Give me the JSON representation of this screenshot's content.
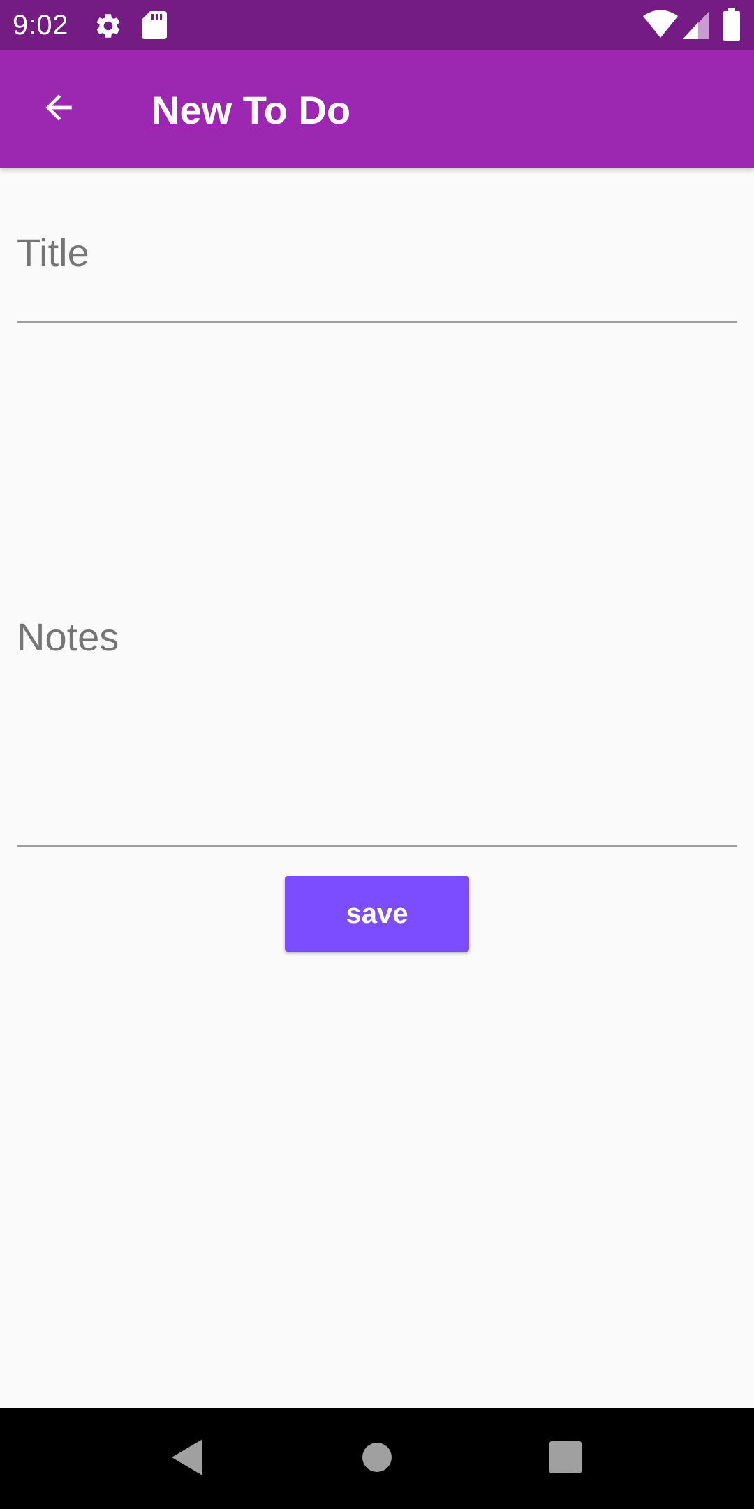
{
  "status_bar": {
    "time": "9:02",
    "icons": [
      "settings-icon",
      "sd-card-icon",
      "wifi-icon",
      "cell-signal-icon",
      "battery-icon"
    ]
  },
  "app_bar": {
    "title": "New To Do",
    "back_icon": "arrow-back-icon"
  },
  "form": {
    "title_field": {
      "placeholder": "Title",
      "value": ""
    },
    "notes_field": {
      "placeholder": "Notes",
      "value": ""
    },
    "save_label": "save"
  },
  "nav_bar": {
    "buttons": [
      "back-triangle-icon",
      "home-circle-icon",
      "recents-square-icon"
    ]
  },
  "colors": {
    "status_bar": "#741c84",
    "app_bar": "#9c27b0",
    "accent_button": "#7c4dff",
    "placeholder_text": "#757575",
    "underline": "#9e9e9e",
    "background": "#fafafa"
  }
}
